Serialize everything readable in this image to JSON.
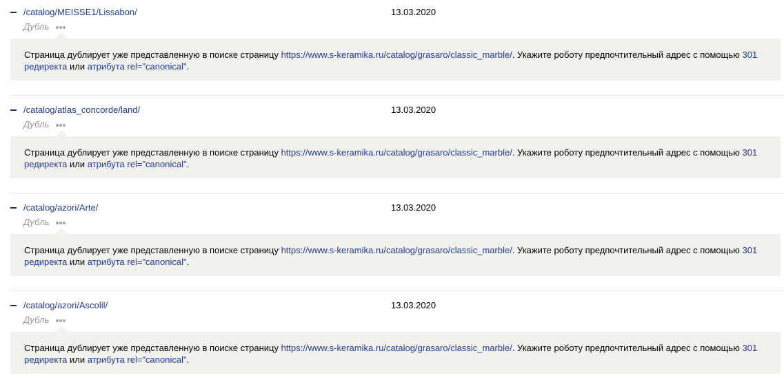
{
  "message": {
    "prefix": "Страница дублирует уже представленную в поиске страницу ",
    "canonical_url": "https://www.s-keramika.ru/catalog/grasaro/classic_marble/",
    "middle": ". Укажите роботу предпочтительный адрес с помощью ",
    "redirect_link": "301 редиректа",
    "or_text": " или ",
    "canonical_link": "атрибута rel=\"canonical\"",
    "suffix": "."
  },
  "entries": [
    {
      "url": "/catalog/MEISSE1/Lissabon/",
      "date": "13.03.2020",
      "status": "Дубль"
    },
    {
      "url": "/catalog/atlas_concorde/land/",
      "date": "13.03.2020",
      "status": "Дубль"
    },
    {
      "url": "/catalog/azori/Arte/",
      "date": "13.03.2020",
      "status": "Дубль"
    },
    {
      "url": "/catalog/azori/Ascolil/",
      "date": "13.03.2020",
      "status": "Дубль"
    }
  ]
}
